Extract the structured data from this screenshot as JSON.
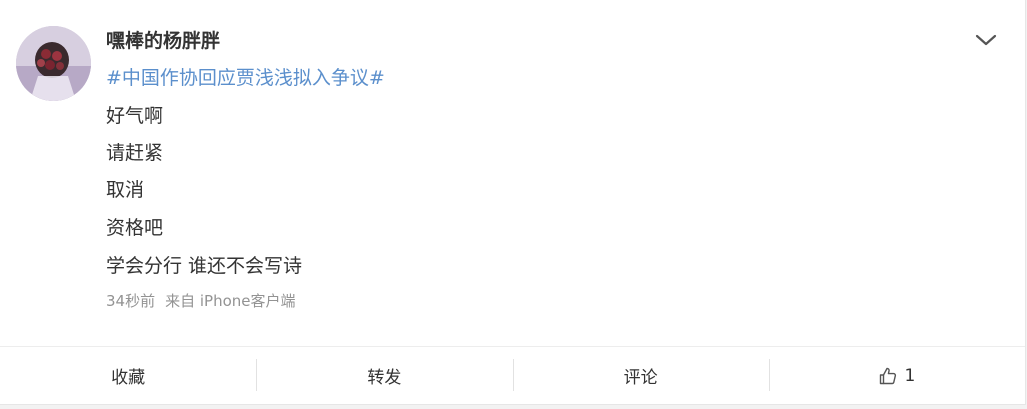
{
  "post": {
    "username": "嘿棒的杨胖胖",
    "topic": "#中国作协回应贾浅浅拟入争议#",
    "lines": [
      "好气啊",
      "请赶紧",
      "取消",
      "资格吧",
      "学会分行 谁还不会写诗"
    ],
    "time": "34秒前",
    "source": "来自 iPhone客户端"
  },
  "actions": {
    "favorite": "收藏",
    "repost": "转发",
    "comment": "评论",
    "like_count": "1"
  },
  "icons": {
    "more": "chevron-down-icon",
    "like": "thumbs-up-icon",
    "avatar": "avatar-image"
  },
  "colors": {
    "topic": "#5b8fcc",
    "text": "#333333",
    "meta": "#939393"
  }
}
